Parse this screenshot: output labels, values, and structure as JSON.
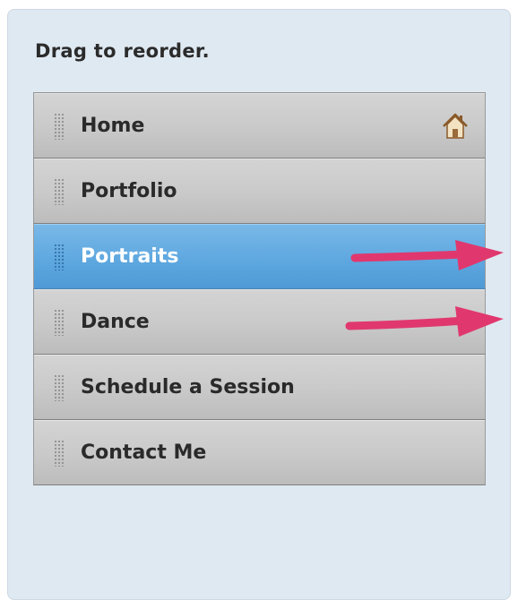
{
  "instructions": "Drag to reorder.",
  "menu": {
    "items": [
      {
        "label": "Home",
        "selected": false,
        "icon": "home-icon"
      },
      {
        "label": "Portfolio",
        "selected": false
      },
      {
        "label": "Portraits",
        "selected": true
      },
      {
        "label": "Dance",
        "selected": false
      },
      {
        "label": "Schedule a Session",
        "selected": false
      },
      {
        "label": "Contact Me",
        "selected": false
      }
    ]
  },
  "colors": {
    "panel_background": "#dfe9f2",
    "item_background": "#c9c9c9",
    "selected_background": "#5fa8e0",
    "arrow": "#e0386e"
  }
}
